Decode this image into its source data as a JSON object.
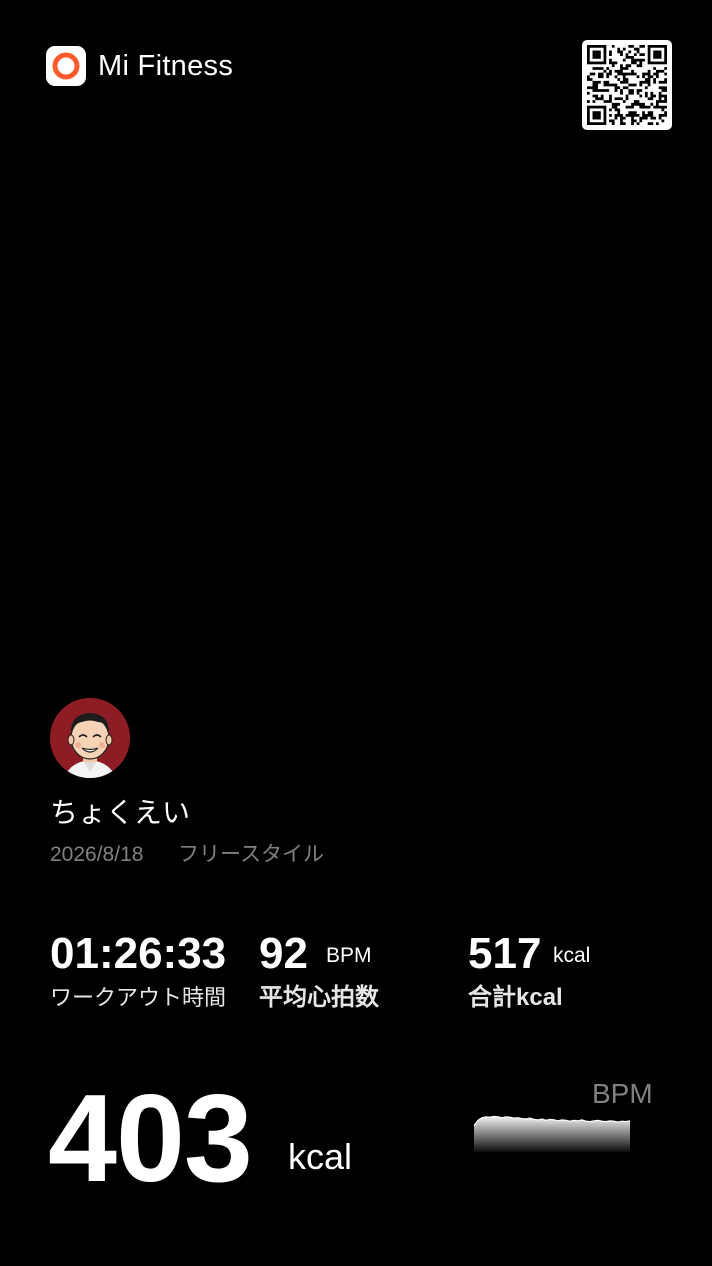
{
  "header": {
    "app_name": "Mi Fitness",
    "logo_icon": "mi-fitness-logo-icon",
    "brand_color": "#ff5a2c",
    "qr_icon": "qr-code-icon"
  },
  "user": {
    "name": "ちょくえい",
    "date": "2026/8/18",
    "workout_type": "フリースタイル"
  },
  "stats": [
    {
      "value": "01:26:33",
      "unit": "",
      "label": "ワークアウト時間"
    },
    {
      "value": "92",
      "unit": "BPM",
      "label": "平均心拍数"
    },
    {
      "value": "517",
      "unit": "kcal",
      "label": "合計kcal"
    }
  ],
  "highlight": {
    "value": "403",
    "unit": "kcal"
  },
  "heart_rate_chart": {
    "label": "BPM",
    "chart_data": {
      "type": "area",
      "series": [
        {
          "values": [
            60,
            72,
            78,
            80,
            79,
            81,
            80,
            78,
            80,
            79,
            77,
            78,
            76,
            75,
            77,
            74,
            73,
            75,
            72,
            74,
            73,
            71,
            73,
            72,
            70,
            72,
            71,
            73,
            70,
            69,
            71,
            72,
            70,
            69,
            71,
            70,
            68,
            70,
            69,
            71
          ]
        }
      ]
    }
  }
}
